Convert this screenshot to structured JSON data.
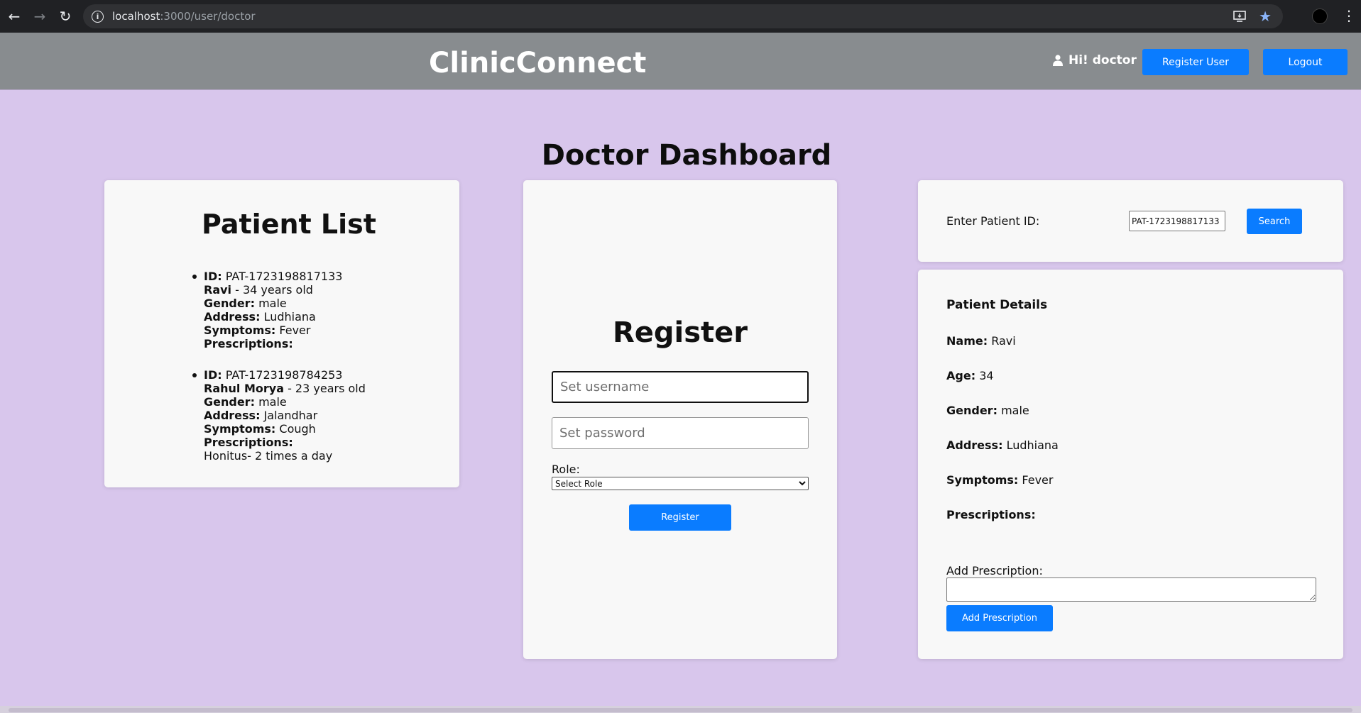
{
  "browser": {
    "url_host": "localhost",
    "url_rest": ":3000/user/doctor"
  },
  "header": {
    "brand": "ClinicConnect",
    "greeting": "Hi! doctor",
    "register_user_label": "Register User",
    "logout_label": "Logout"
  },
  "page": {
    "title": "Doctor Dashboard"
  },
  "patient_list": {
    "title": "Patient List",
    "labels": {
      "id": "ID:",
      "gender": "Gender:",
      "address": "Address:",
      "symptoms": "Symptoms:",
      "prescriptions": "Prescriptions:"
    },
    "patients": [
      {
        "id": "PAT-1723198817133",
        "name": "Ravi",
        "age_text": " - 34 years old",
        "gender": "male",
        "address": "Ludhiana",
        "symptoms": "Fever",
        "prescriptions": ""
      },
      {
        "id": "PAT-1723198784253",
        "name": "Rahul Morya",
        "age_text": " - 23 years old",
        "gender": "male",
        "address": "Jalandhar",
        "symptoms": "Cough",
        "prescriptions": "Honitus- 2 times a day"
      }
    ]
  },
  "register": {
    "title": "Register",
    "username_placeholder": "Set username",
    "password_placeholder": "Set password",
    "role_label": "Role:",
    "role_selected": "Select Role",
    "button_label": "Register"
  },
  "search": {
    "label": "Enter Patient ID:",
    "value": "PAT-1723198817133",
    "button_label": "Search"
  },
  "details": {
    "heading": "Patient Details",
    "name_label": "Name:",
    "name": "Ravi",
    "age_label": "Age:",
    "age": "34",
    "gender_label": "Gender:",
    "gender": "male",
    "address_label": "Address:",
    "address": "Ludhiana",
    "symptoms_label": "Symptoms:",
    "symptoms": "Fever",
    "prescriptions_label": "Prescriptions:",
    "add_prescription_label": "Add Prescription:",
    "add_prescription_button": "Add Prescription"
  },
  "colors": {
    "primary_button": "#0a7cff",
    "header_bg": "#888c8f",
    "page_bg": "#d8c6ec",
    "card_bg": "#f8f8f8"
  }
}
